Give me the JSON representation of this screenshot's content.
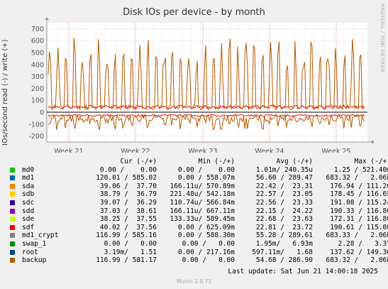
{
  "chart_data": {
    "type": "line",
    "title": "Disk IOs per device - by month",
    "ylabel": "IOs/second read (-) / write (+)",
    "vendor": "RRDTOOL / TOBI OETIKER",
    "ylim": [
      -250,
      750
    ],
    "yticks": [
      -200,
      -100,
      0,
      100,
      200,
      300,
      400,
      500,
      600,
      700
    ],
    "xticks": [
      "Week 21",
      "Week 22",
      "Week 23",
      "Week 24",
      "Week 25"
    ],
    "grid": true,
    "colors": {
      "background": "#f0f0f0",
      "plot": "#ffffff",
      "grid": "#dcb0b0",
      "axis": "#999999",
      "zero_line": "#000000"
    },
    "legend": {
      "headers": [
        "",
        "Cur (-/+)",
        "Min (-/+)",
        "Avg (-/+)",
        "Max (-/+)"
      ],
      "rows": [
        {
          "name": "md0",
          "color": "#00cc00",
          "cur": "0.00 /    0.00",
          "min": "0.00 /    0.00",
          "avg": "1.01m/ 240.35u",
          "max": "1.25 / 521.40m"
        },
        {
          "name": "md1",
          "color": "#0066b3",
          "cur": "120.01 / 585.02",
          "min": "0.00 / 558.07m",
          "avg": "56.60 / 289.47",
          "max": "683.32 /   2.06k"
        },
        {
          "name": "sda",
          "color": "#ff8000",
          "cur": "39.06 /  37.70",
          "min": "166.11u/ 570.89m",
          "avg": "22.42 /  23.31",
          "max": "176.94 / 111.20"
        },
        {
          "name": "sdb",
          "color": "#ffcc00",
          "cur": "38.79 /  36.79",
          "min": "221.48u/ 542.18m",
          "avg": "22.57 /  23.05",
          "max": "178.45 / 116.65"
        },
        {
          "name": "sdc",
          "color": "#330099",
          "cur": "39.07 /  36.29",
          "min": "110.74u/ 566.84m",
          "avg": "22.56 /  23.33",
          "max": "191.08 / 115.24"
        },
        {
          "name": "sdd",
          "color": "#990099",
          "cur": "37.03 /  38.61",
          "min": "166.11u/ 667.11m",
          "avg": "22.15 /  24.22",
          "max": "190.33 / 116.86"
        },
        {
          "name": "sde",
          "color": "#ccff00",
          "cur": "38.25 /  37.55",
          "min": "133.33u/ 589.45m",
          "avg": "22.68 /  23.63",
          "max": "172.31 / 116.80"
        },
        {
          "name": "sdf",
          "color": "#ff0000",
          "cur": "40.02 /  37.56",
          "min": "0.00 / 625.09m",
          "avg": "22.81 /  23.72",
          "max": "190.61 / 115.08"
        },
        {
          "name": "md1_crypt",
          "color": "#808080",
          "cur": "116.99 / 585.16",
          "min": "0.00 / 588.30m",
          "avg": "55.28 / 289.61",
          "max": "683.33 /   2.06k"
        },
        {
          "name": "swap_1",
          "color": "#008f00",
          "cur": "0.00 /   0.00",
          "min": "0.00 /   0.00",
          "avg": "1.95m/   6.93m",
          "max": "2.28 /   3.37"
        },
        {
          "name": "root",
          "color": "#00487d",
          "cur": "3.19m/   1.51",
          "min": "0.00 / 217.16m",
          "avg": "597.11m/   1.68",
          "max": "137.62 / 149.36"
        },
        {
          "name": "backup",
          "color": "#b35a00",
          "cur": "116.99 / 581.17",
          "min": "0.00 /   0.00",
          "avg": "54.68 / 286.90",
          "max": "683.32 /   2.06k"
        }
      ]
    }
  },
  "footer": {
    "last_update": "Last update: Sat Jun 21 14:00:18 2025",
    "version": "Munin 2.0.73"
  }
}
